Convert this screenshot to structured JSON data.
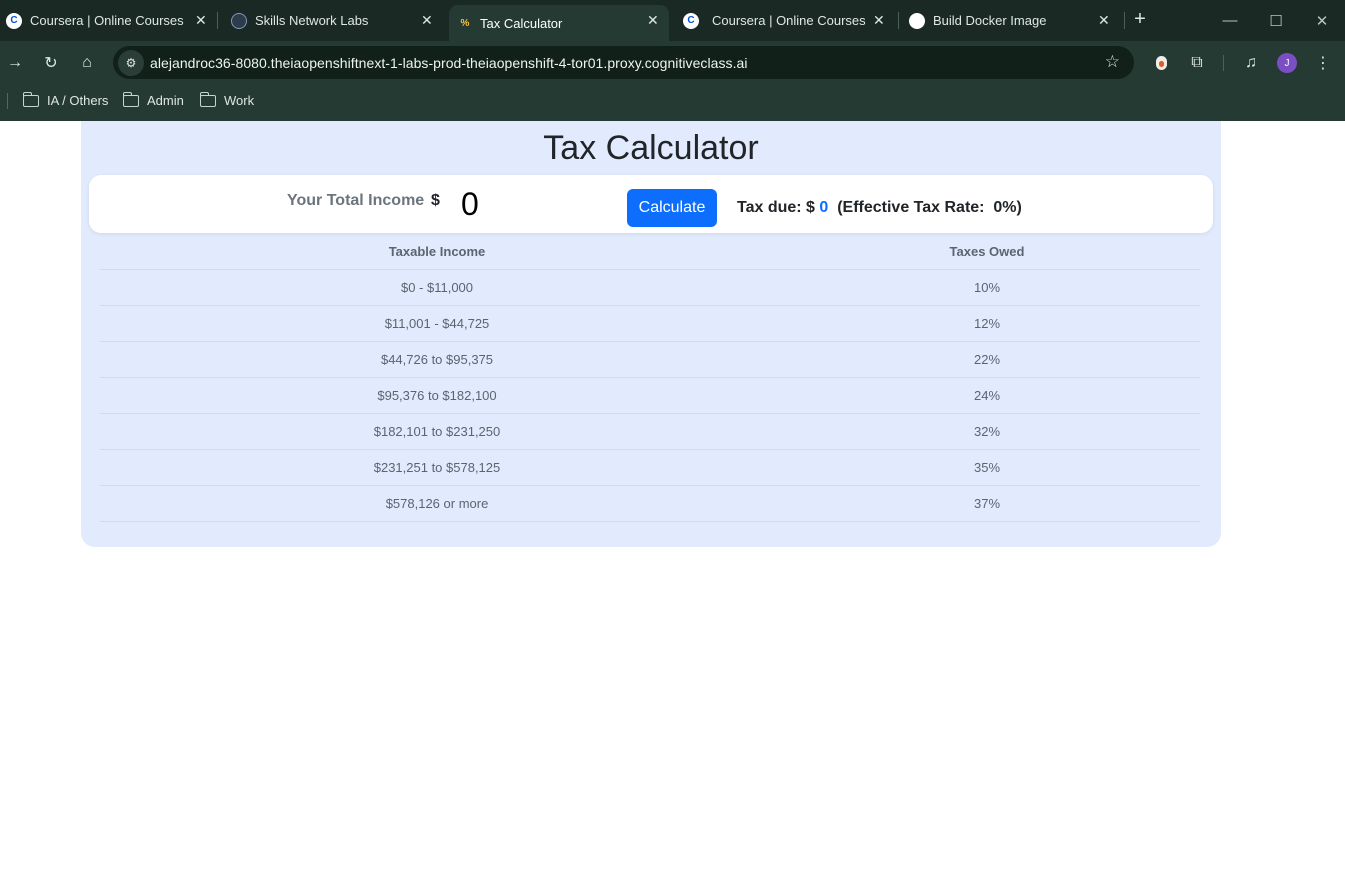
{
  "browser": {
    "tabs": [
      {
        "title": "Coursera | Online Courses From",
        "favicon": "coursera-icon",
        "active": false
      },
      {
        "title": "Skills Network Labs",
        "favicon": "skills-network-icon",
        "active": false
      },
      {
        "title": "Tax Calculator",
        "favicon": "percent-icon",
        "active": true
      },
      {
        "title": "Coursera | Online Courses From",
        "favicon": "coursera-icon",
        "active": false
      },
      {
        "title": "Build Docker Image",
        "favicon": "openai-icon",
        "active": false
      }
    ],
    "url": "alejandroc36-8080.theiaopenshiftnext-1-labs-prod-theiaopenshift-4-tor01.proxy.cognitiveclass.ai",
    "profile_initial": "J",
    "bookmarks": [
      "IA / Others",
      "Admin",
      "Work"
    ]
  },
  "page": {
    "title": "Tax Calculator",
    "income_label": "Your Total Income",
    "currency_symbol": "$",
    "income_value": "0",
    "calculate_label": "Calculate",
    "tax_due_label": "Tax due: $",
    "tax_due_value": "0",
    "rate_prefix": "(Effective Tax Rate:",
    "rate_value": "0%)",
    "table": {
      "headers": [
        "Taxable Income",
        "Taxes Owed"
      ],
      "rows": [
        [
          "$0 - $11,000",
          "10%"
        ],
        [
          "$11,001 - $44,725",
          "12%"
        ],
        [
          "$44,726 to $95,375",
          "22%"
        ],
        [
          "$95,376 to $182,100",
          "24%"
        ],
        [
          "$182,101 to $231,250",
          "32%"
        ],
        [
          "$231,251 to $578,125",
          "35%"
        ],
        [
          "$578,126 or more",
          "37%"
        ]
      ]
    }
  },
  "colors": {
    "chrome_dark": "#1a2924",
    "chrome": "#253a33",
    "app_bg": "#e1ebfd",
    "accent": "#0d6efd"
  }
}
